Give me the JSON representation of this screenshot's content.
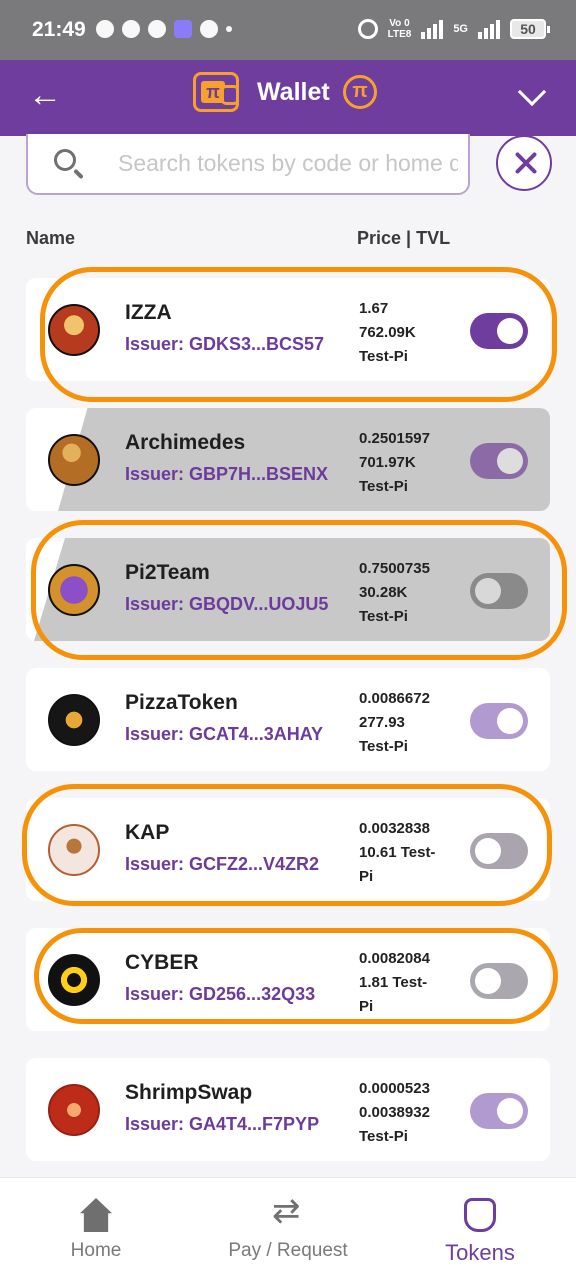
{
  "status_bar": {
    "time": "21:49",
    "network_top": "Vo 0",
    "network_bottom": "LTE8",
    "signal_5g": "5G",
    "battery": "50"
  },
  "header": {
    "title": "Wallet",
    "pi_symbol": "π",
    "back_icon": "arrow-left-icon",
    "menu_icon": "chevron-down-icon"
  },
  "search": {
    "placeholder": "Search tokens by code or home domain",
    "value": ""
  },
  "columns": {
    "name": "Name",
    "price": "Price | TVL"
  },
  "tokens": [
    {
      "name": "IZZA",
      "issuer": "Issuer: GDKS3...BCS57",
      "price": "1.67",
      "tvl": "762.09K",
      "unit": "Test-Pi",
      "enabled": true,
      "highlighted": true,
      "shaded": false,
      "logo_color": "#b53a1e",
      "toggle_color": "#6f3d9e"
    },
    {
      "name": "Archimedes",
      "issuer": "Issuer: GBP7H...BSENX",
      "price": "0.2501597",
      "tvl": "701.97K",
      "unit": "Test-Pi",
      "enabled": true,
      "highlighted": false,
      "shaded": true,
      "logo_color": "#b46d24",
      "toggle_color": "#8c6aa5"
    },
    {
      "name": "Pi2Team",
      "issuer": "Issuer: GBQDV...UOJU5",
      "price": "0.7500735",
      "tvl": "30.28K",
      "unit": "Test-Pi",
      "enabled": false,
      "highlighted": true,
      "shaded": true,
      "logo_color": "#8b4fc7",
      "toggle_color": "#8a8a8a"
    },
    {
      "name": "PizzaToken",
      "issuer": "Issuer: GCAT4...3AHAY",
      "price": "0.0086672",
      "tvl": "277.93",
      "unit": "Test-Pi",
      "enabled": true,
      "highlighted": false,
      "shaded": false,
      "logo_color": "#161616",
      "toggle_color": "#b09ad0"
    },
    {
      "name": "KAP",
      "issuer": "Issuer: GCFZ2...V4ZR2",
      "price": "0.0032838",
      "tvl": "10.61 Test-",
      "unit": "Pi",
      "enabled": false,
      "highlighted": true,
      "shaded": false,
      "logo_color": "#f3e6df",
      "toggle_color": "#a9a4ad"
    },
    {
      "name": "CYBER",
      "issuer": "Issuer: GD256...32Q33",
      "price": "0.0082084",
      "tvl": "1.81 Test-",
      "unit": "Pi",
      "enabled": false,
      "highlighted": true,
      "shaded": false,
      "logo_color": "#111111",
      "toggle_color": "#aaa8ae"
    },
    {
      "name": "ShrimpSwap",
      "issuer": "Issuer: GA4T4...F7PYP",
      "price": "0.0000523",
      "tvl": "0.0038932",
      "unit": "Test-Pi",
      "enabled": true,
      "highlighted": false,
      "shaded": false,
      "logo_color": "#bd2c18",
      "toggle_color": "#b09ad0"
    }
  ],
  "bottom_nav": [
    {
      "label": "Home",
      "icon": "home-icon"
    },
    {
      "label": "Pay / Request",
      "icon": "swap-icon"
    },
    {
      "label": "Tokens",
      "icon": "pi-bag-icon",
      "active": true
    }
  ],
  "colors": {
    "primary": "#6f3d9e",
    "accent": "#f5920a"
  }
}
